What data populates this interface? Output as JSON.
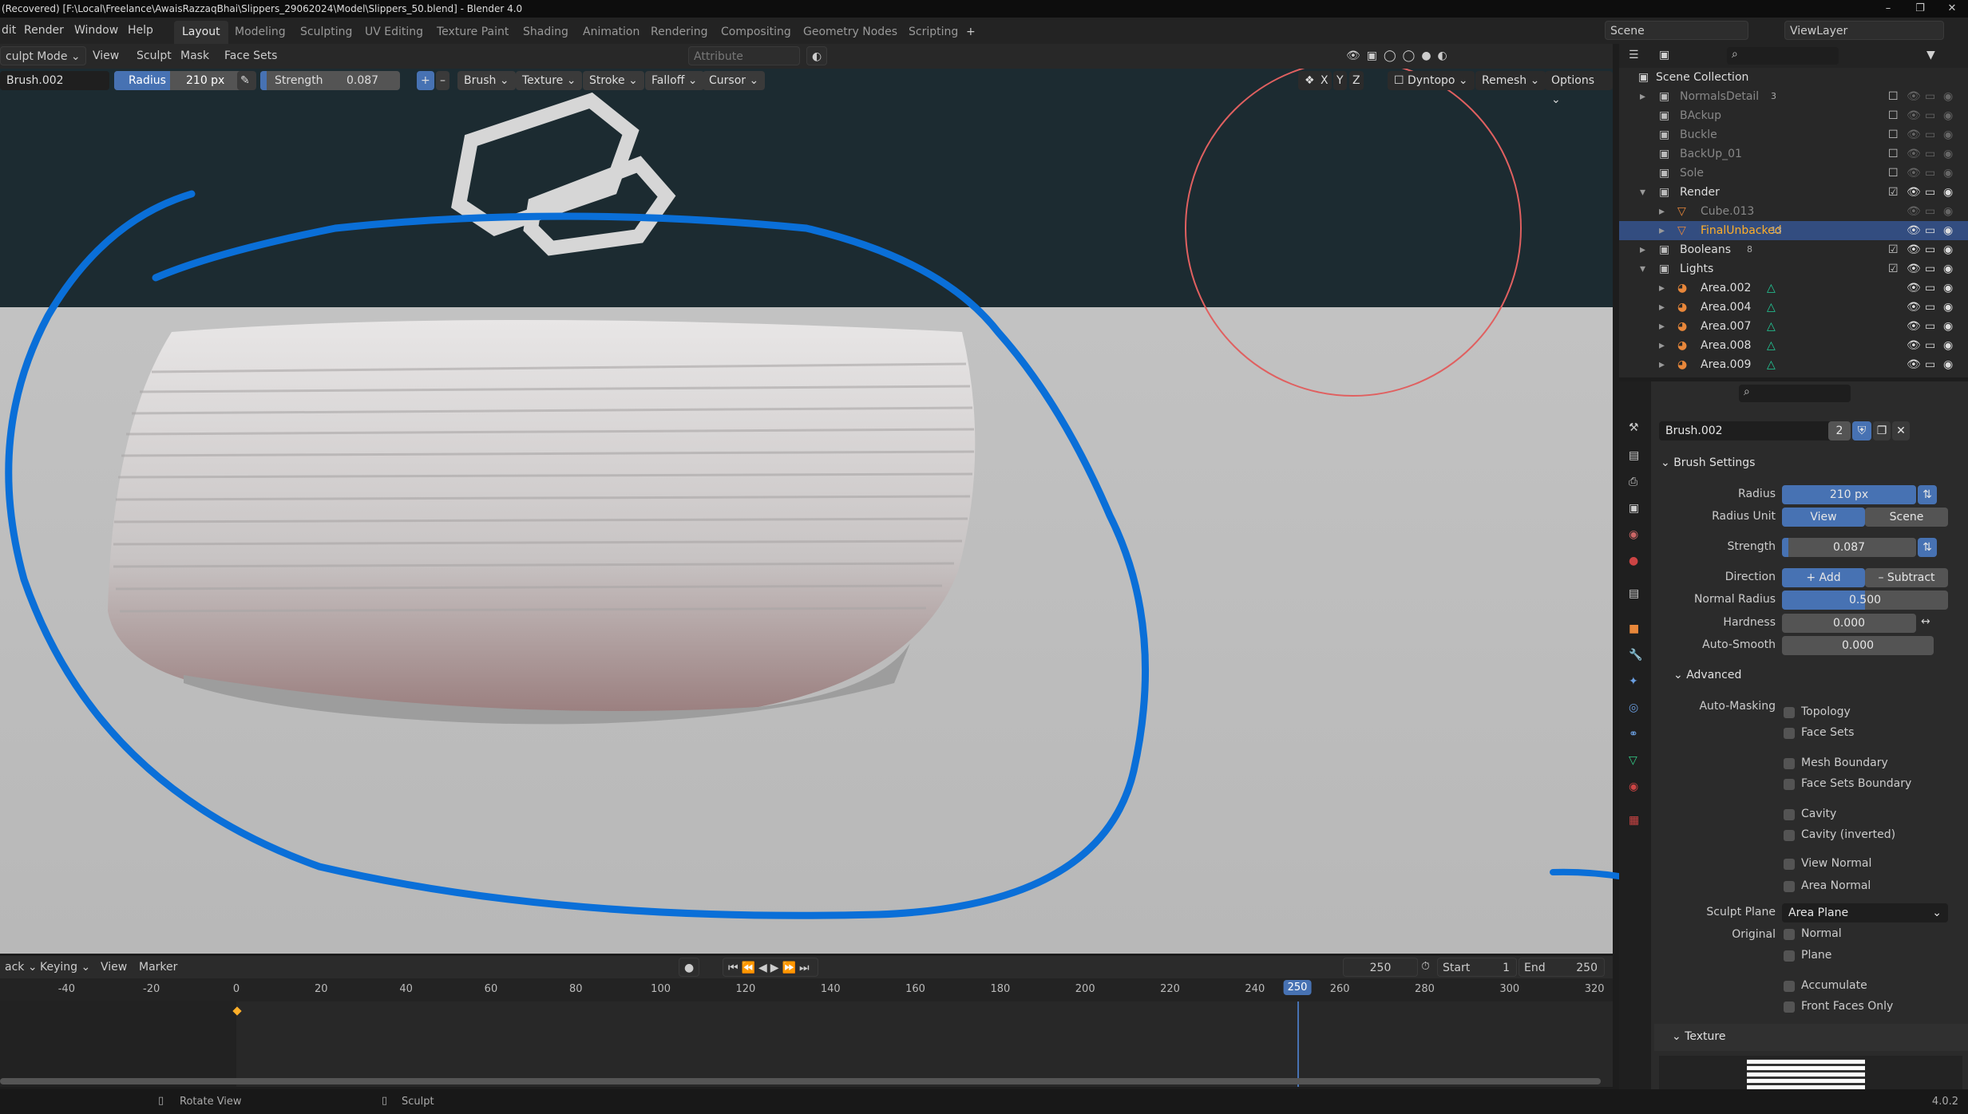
{
  "title": "(Recovered) [F:\\Local\\Freelance\\AwaisRazzaqBhai\\Slippers_29062024\\Model\\Slippers_50.blend] - Blender 4.0",
  "menu": [
    "dit",
    "Render",
    "Window",
    "Help"
  ],
  "workspaces": [
    "Layout",
    "Modeling",
    "Sculpting",
    "UV Editing",
    "Texture Paint",
    "Shading",
    "Animation",
    "Rendering",
    "Compositing",
    "Geometry Nodes",
    "Scripting",
    "+"
  ],
  "scene": "Scene",
  "view_layer": "ViewLayer",
  "header": {
    "mode": "culpt Mode",
    "items": [
      "View",
      "Sculpt",
      "Mask",
      "Face Sets"
    ],
    "attribute": "Attribute"
  },
  "toolbar": {
    "brush": "Brush.002",
    "radius_label": "Radius",
    "radius": "210 px",
    "strength_label": "Strength",
    "strength": "0.087",
    "menus": [
      "Brush",
      "Texture",
      "Stroke",
      "Falloff",
      "Cursor"
    ],
    "axes": [
      "X",
      "Y",
      "Z"
    ],
    "dyntopo": "Dyntopo",
    "remesh": "Remesh",
    "options": "Options"
  },
  "outliner": {
    "root": "Scene Collection",
    "rows": [
      {
        "name": "NormalsDetail",
        "badge": "3",
        "dim": true
      },
      {
        "name": "BAckup",
        "dim": true
      },
      {
        "name": "Buckle",
        "dim": true
      },
      {
        "name": "BackUp_01",
        "dim": true
      },
      {
        "name": "Sole",
        "dim": true
      },
      {
        "name": "Render"
      },
      {
        "name": "Cube.013",
        "dim": true
      },
      {
        "name": "FinalUnbacked",
        "selected": true,
        "badge": "13"
      },
      {
        "name": "Booleans",
        "badge": "8"
      },
      {
        "name": "Lights"
      },
      {
        "name": "Area.002"
      },
      {
        "name": "Area.004"
      },
      {
        "name": "Area.007"
      },
      {
        "name": "Area.008"
      },
      {
        "name": "Area.009"
      }
    ]
  },
  "props": {
    "brush": "Brush.002",
    "users": "2",
    "brush_settings": "Brush Settings",
    "radius_label": "Radius",
    "radius": "210 px",
    "radius_unit_label": "Radius Unit",
    "unit_view": "View",
    "unit_scene": "Scene",
    "strength_label": "Strength",
    "strength": "0.087",
    "direction_label": "Direction",
    "add": "Add",
    "subtract": "Subtract",
    "normal_radius_label": "Normal Radius",
    "normal_radius": "0.500",
    "hardness_label": "Hardness",
    "hardness": "0.000",
    "autosmooth_label": "Auto-Smooth",
    "autosmooth": "0.000",
    "advanced": "Advanced",
    "automasking_label": "Auto-Masking",
    "masks": [
      "Topology",
      "Face Sets",
      "Mesh Boundary",
      "Face Sets Boundary",
      "Cavity",
      "Cavity (inverted)",
      "View Normal",
      "Area Normal"
    ],
    "sculpt_plane_label": "Sculpt Plane",
    "sculpt_plane": "Area Plane",
    "original_label": "Original",
    "original": [
      "Normal",
      "Plane"
    ],
    "accumulate": "Accumulate",
    "front_faces": "Front Faces Only",
    "texture": "Texture"
  },
  "timeline": {
    "menus": [
      "ack",
      "Keying",
      "View",
      "Marker"
    ],
    "current": "250",
    "start_label": "Start",
    "start": "1",
    "end_label": "End",
    "end": "250",
    "ticks": [
      "-40",
      "-20",
      "0",
      "20",
      "40",
      "60",
      "80",
      "100",
      "120",
      "140",
      "160",
      "180",
      "200",
      "220",
      "240",
      "250",
      "260",
      "280",
      "300",
      "320"
    ]
  },
  "status": {
    "rotate": "Rotate View",
    "sculpt": "Sculpt",
    "version": "4.0.2"
  },
  "colors": {
    "accent": "#4772b3",
    "annotation": "#0a6fd8",
    "selected_text": "#ffaf29"
  }
}
